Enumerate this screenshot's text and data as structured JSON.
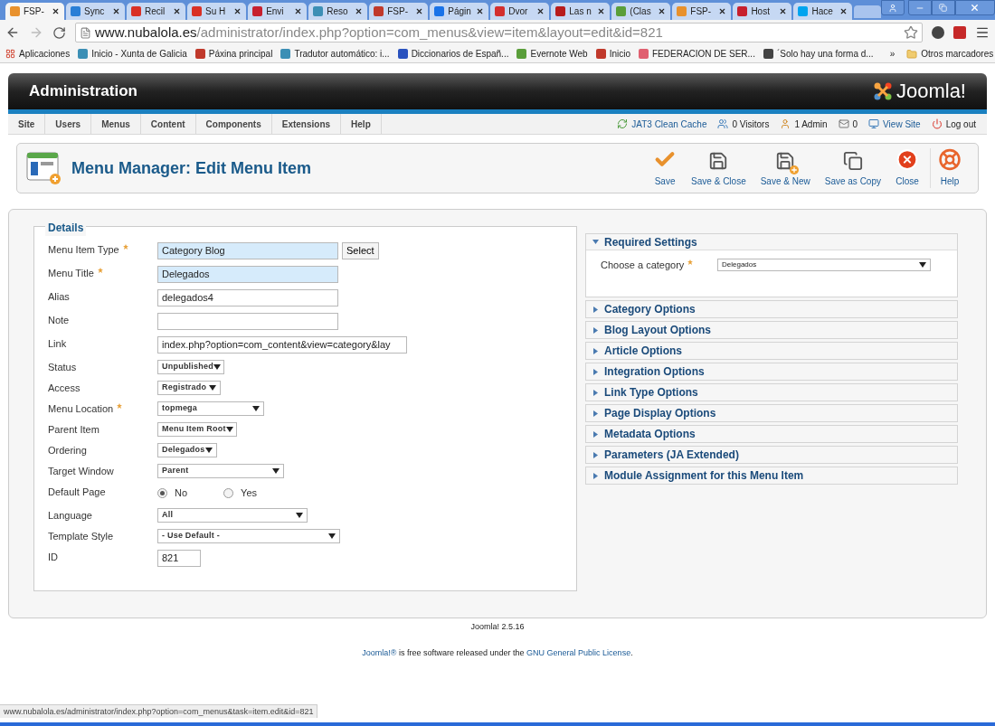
{
  "browser": {
    "tabs": [
      {
        "title": "FSP-",
        "selected": true
      },
      {
        "title": "Sync",
        "selected": false
      },
      {
        "title": "Recil",
        "selected": false
      },
      {
        "title": "Su H",
        "selected": false
      },
      {
        "title": "Envi",
        "selected": false
      },
      {
        "title": "Reso",
        "selected": false
      },
      {
        "title": "FSP-",
        "selected": false
      },
      {
        "title": "Págin",
        "selected": false
      },
      {
        "title": "Dvor",
        "selected": false
      },
      {
        "title": "Las n",
        "selected": false
      },
      {
        "title": "(Clas",
        "selected": false
      },
      {
        "title": "FSP-",
        "selected": false
      },
      {
        "title": "Host",
        "selected": false
      },
      {
        "title": "Hace",
        "selected": false
      }
    ],
    "url": {
      "host": "www.nubalola.es",
      "path": "/administrator/index.php?option=com_menus&view=item&layout=edit&id=821"
    },
    "bookmarks": [
      {
        "label": "Aplicaciones"
      },
      {
        "label": "Inicio - Xunta de Galicia"
      },
      {
        "label": "Páxina principal"
      },
      {
        "label": "Tradutor automático: i..."
      },
      {
        "label": "Diccionarios de Españ..."
      },
      {
        "label": "Evernote Web"
      },
      {
        "label": "Inicio"
      },
      {
        "label": "FEDERACION DE SER..."
      },
      {
        "label": "´Solo hay una forma d..."
      }
    ],
    "bookmarks_more": "»",
    "other_bookmarks": "Otros marcadores",
    "status_url": "www.nubalola.es/administrator/index.php?option=com_menus&task=item.edit&id=821"
  },
  "header": {
    "title": "Administration",
    "logo": "Joomla!"
  },
  "menu": {
    "items": [
      "Site",
      "Users",
      "Menus",
      "Content",
      "Components",
      "Extensions",
      "Help"
    ],
    "status": [
      {
        "kind": "cache",
        "label": "JAT3 Clean Cache"
      },
      {
        "kind": "visitors",
        "label": "0 Visitors"
      },
      {
        "kind": "admin",
        "label": "1 Admin"
      },
      {
        "kind": "messages",
        "label": "0"
      },
      {
        "kind": "view",
        "label": "View Site"
      },
      {
        "kind": "logout",
        "label": "Log out"
      }
    ]
  },
  "toolbar": {
    "title": "Menu Manager: Edit Menu Item",
    "buttons": [
      {
        "kind": "save",
        "label": "Save"
      },
      {
        "kind": "save-close",
        "label": "Save & Close"
      },
      {
        "kind": "save-new",
        "label": "Save & New"
      },
      {
        "kind": "save-copy",
        "label": "Save as Copy"
      },
      {
        "kind": "close",
        "label": "Close"
      },
      {
        "kind": "help",
        "label": "Help"
      }
    ]
  },
  "details": {
    "legend": "Details",
    "fields": [
      {
        "kind": "text",
        "label": "Menu Item Type",
        "required": true,
        "value": "Category Blog",
        "highlighted": true,
        "button": "Select"
      },
      {
        "kind": "text",
        "label": "Menu Title",
        "required": true,
        "value": "Delegados",
        "highlighted": true
      },
      {
        "kind": "text",
        "label": "Alias",
        "required": false,
        "value": "delegados4",
        "highlighted": false
      },
      {
        "kind": "text",
        "label": "Note",
        "required": false,
        "highlighted": false
      },
      {
        "kind": "text",
        "label": "Link",
        "required": false,
        "value": "index.php?option=com_content&view=category&lay",
        "highlighted": false
      },
      {
        "kind": "select",
        "label": "Status",
        "required": false,
        "value": "Unpublished"
      },
      {
        "kind": "select",
        "label": "Access",
        "required": false,
        "value": "Registrado"
      },
      {
        "kind": "select",
        "label": "Menu Location",
        "required": true,
        "value": "topmega"
      },
      {
        "kind": "select",
        "label": "Parent Item",
        "required": false,
        "value": "Menu Item Root"
      },
      {
        "kind": "select",
        "label": "Ordering",
        "required": false,
        "value": "Delegados"
      },
      {
        "kind": "select",
        "label": "Target Window",
        "required": false,
        "value": "Parent"
      },
      {
        "kind": "radio",
        "label": "Default Page",
        "required": false,
        "options": [
          {
            "label": "No",
            "selected": true
          },
          {
            "label": "Yes",
            "selected": false
          }
        ]
      },
      {
        "kind": "select",
        "label": "Language",
        "required": false,
        "value": "All"
      },
      {
        "kind": "select",
        "label": "Template Style",
        "required": false,
        "value": "- Use Default -"
      },
      {
        "kind": "text",
        "label": "ID",
        "required": false,
        "value": "821",
        "highlighted": false
      }
    ]
  },
  "panels": [
    {
      "title": "Required Settings",
      "expanded": true,
      "fields": [
        {
          "label": "Choose a category",
          "required": true,
          "value": "Delegados"
        }
      ]
    },
    {
      "title": "Category Options",
      "expanded": false
    },
    {
      "title": "Blog Layout Options",
      "expanded": false
    },
    {
      "title": "Article Options",
      "expanded": false
    },
    {
      "title": "Integration Options",
      "expanded": false
    },
    {
      "title": "Link Type Options",
      "expanded": false
    },
    {
      "title": "Page Display Options",
      "expanded": false
    },
    {
      "title": "Metadata Options",
      "expanded": false
    },
    {
      "title": "Parameters (JA Extended)",
      "expanded": false
    },
    {
      "title": "Module Assignment for this Menu Item",
      "expanded": false
    }
  ],
  "footer": {
    "version": "Joomla! 2.5.16",
    "license": [
      {
        "text": "Joomla!®",
        "link": true
      },
      {
        "text": " is free software released under the ",
        "link": false
      },
      {
        "text": "GNU General Public License",
        "link": true
      },
      {
        "text": ".",
        "link": false
      }
    ]
  }
}
